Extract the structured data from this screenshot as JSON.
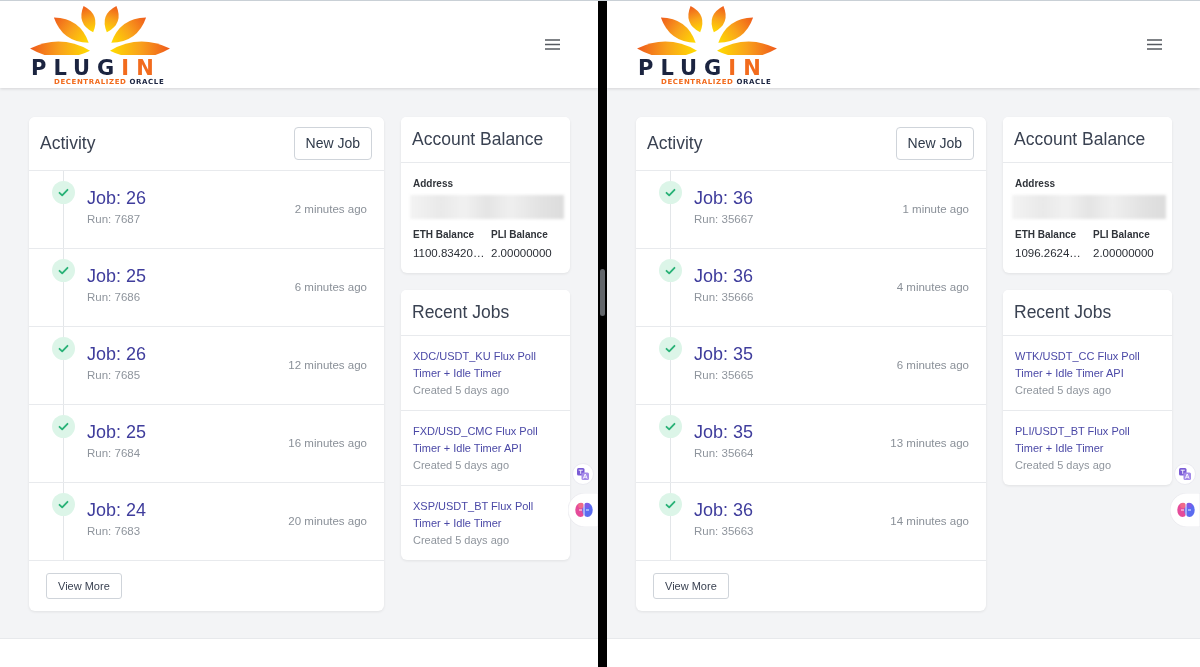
{
  "panes": [
    {
      "header": {
        "logo": {
          "wordmark_dark": "PLUG",
          "wordmark_accent": "IN",
          "tagline_accent": "DECENTRALIZED",
          "tagline_dark": "ORACLE"
        }
      },
      "activity": {
        "title": "Activity",
        "new_job_button": "New Job",
        "items": [
          {
            "job": "Job: 26",
            "run": "Run: 7687",
            "time": "2 minutes ago",
            "completed": true
          },
          {
            "job": "Job: 25",
            "run": "Run: 7686",
            "time": "6 minutes ago",
            "completed": true
          },
          {
            "job": "Job: 26",
            "run": "Run: 7685",
            "time": "12 minutes ago",
            "completed": true
          },
          {
            "job": "Job: 25",
            "run": "Run: 7684",
            "time": "16 minutes ago",
            "completed": true
          },
          {
            "job": "Job: 24",
            "run": "Run: 7683",
            "time": "20 minutes ago",
            "completed": true
          }
        ],
        "view_more_button": "View More"
      },
      "account_balance": {
        "title": "Account Balance",
        "address_label": "Address",
        "eth_balance_label": "ETH Balance",
        "eth_balance": "1100.83420…",
        "pli_balance_label": "PLI Balance",
        "pli_balance": "2.00000000"
      },
      "recent_jobs": {
        "title": "Recent Jobs",
        "items": [
          {
            "name": "XDC/USDT_KU Flux Poll Timer + Idle Timer",
            "created": "Created 5 days ago"
          },
          {
            "name": "FXD/USD_CMC Flux Poll Timer + Idle Timer API",
            "created": "Created 5 days ago"
          },
          {
            "name": "XSP/USDT_BT Flux Poll Timer + Idle Timer",
            "created": "Created 5 days ago"
          }
        ]
      }
    },
    {
      "header": {
        "logo": {
          "wordmark_dark": "PLUG",
          "wordmark_accent": "IN",
          "tagline_accent": "DECENTRALIZED",
          "tagline_dark": "ORACLE"
        }
      },
      "activity": {
        "title": "Activity",
        "new_job_button": "New Job",
        "items": [
          {
            "job": "Job: 36",
            "run": "Run: 35667",
            "time": "1 minute ago",
            "completed": true
          },
          {
            "job": "Job: 36",
            "run": "Run: 35666",
            "time": "4 minutes ago",
            "completed": true
          },
          {
            "job": "Job: 35",
            "run": "Run: 35665",
            "time": "6 minutes ago",
            "completed": true
          },
          {
            "job": "Job: 35",
            "run": "Run: 35664",
            "time": "13 minutes ago",
            "completed": true
          },
          {
            "job": "Job: 36",
            "run": "Run: 35663",
            "time": "14 minutes ago",
            "completed": true
          }
        ],
        "view_more_button": "View More"
      },
      "account_balance": {
        "title": "Account Balance",
        "address_label": "Address",
        "eth_balance_label": "ETH Balance",
        "eth_balance": "1096.2624…",
        "pli_balance_label": "PLI Balance",
        "pli_balance": "2.00000000"
      },
      "recent_jobs": {
        "title": "Recent Jobs",
        "items": [
          {
            "name": "WTK/USDT_CC Flux Poll Timer + Idle Timer API",
            "created": "Created 5 days ago"
          },
          {
            "name": "PLI/USDT_BT Flux Poll Timer + Idle Timer",
            "created": "Created 5 days ago"
          }
        ]
      }
    }
  ]
}
